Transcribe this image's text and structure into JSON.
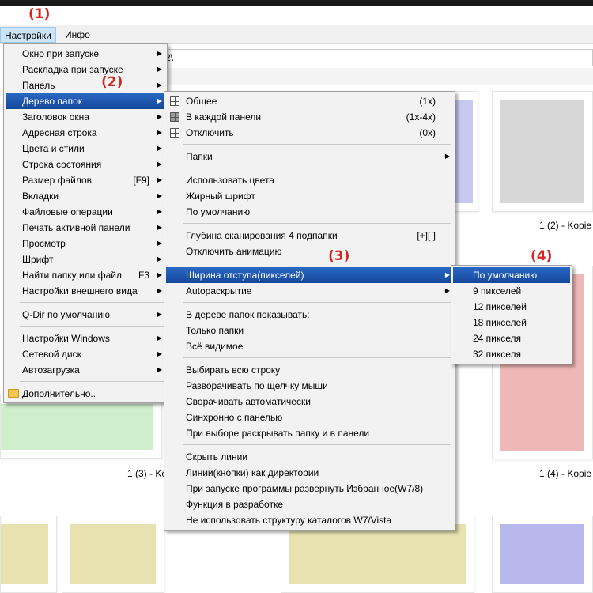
{
  "menubar": {
    "settings": "Настройки",
    "info": "Инфо"
  },
  "address": {
    "value": "2\\"
  },
  "captions": [
    "1 (2) - Kopie",
    "1 (3) - Ko",
    "1 (4) - Kopie"
  ],
  "annotations": [
    "(1)",
    "(2)",
    "(3)",
    "(4)"
  ],
  "menu_settings": {
    "items": [
      {
        "label": "Окно при запуске",
        "shortcut": ""
      },
      {
        "label": "Раскладка при запуске",
        "shortcut": ""
      },
      {
        "label": "Панель",
        "shortcut": ""
      },
      {
        "label": "Дерево папок",
        "shortcut": ""
      },
      {
        "label": "Заголовок окна",
        "shortcut": ""
      },
      {
        "label": "Адресная строка",
        "shortcut": ""
      },
      {
        "label": "Цвета и стили",
        "shortcut": ""
      },
      {
        "label": "Строка состояния",
        "shortcut": ""
      },
      {
        "label": "Размер файлов",
        "shortcut": "[F9]"
      },
      {
        "label": "Вкладки",
        "shortcut": ""
      },
      {
        "label": "Файловые операции",
        "shortcut": ""
      },
      {
        "label": "Печать активной панели",
        "shortcut": ""
      },
      {
        "label": "Просмотр",
        "shortcut": ""
      },
      {
        "label": "Шрифт",
        "shortcut": ""
      },
      {
        "label": "Найти папку или файл",
        "shortcut": "F3"
      },
      {
        "label": "Настройки внешнего вида",
        "shortcut": ""
      },
      {
        "label": "Q-Dir по умолчанию",
        "shortcut": ""
      },
      {
        "label": "Настройки Windows",
        "shortcut": ""
      },
      {
        "label": "Сетевой диск",
        "shortcut": ""
      },
      {
        "label": "Автозагрузка",
        "shortcut": ""
      },
      {
        "label": "Дополнительно..",
        "shortcut": ""
      }
    ]
  },
  "menu_tree": {
    "items": [
      {
        "label": "Общее",
        "shortcut": "(1x)"
      },
      {
        "label": "В каждой панели",
        "shortcut": "(1x-4x)"
      },
      {
        "label": "Отключить",
        "shortcut": "(0x)"
      },
      {
        "label": "Папки",
        "shortcut": ""
      },
      {
        "label": "Использовать цвета",
        "shortcut": ""
      },
      {
        "label": "Жирный шрифт",
        "shortcut": ""
      },
      {
        "label": "По умолчанию",
        "shortcut": ""
      },
      {
        "label": "Глубина сканирования 4 подпапки",
        "shortcut": "[+][ ]"
      },
      {
        "label": "Отключить анимацию",
        "shortcut": ""
      },
      {
        "label": "Ширина отступа(пикселей)",
        "shortcut": ""
      },
      {
        "label": "Autoраскрытие",
        "shortcut": ""
      },
      {
        "label": "В дереве папок показывать:",
        "shortcut": ""
      },
      {
        "label": "Только папки",
        "shortcut": ""
      },
      {
        "label": "Всё видимое",
        "shortcut": ""
      },
      {
        "label": "Выбирать всю строку",
        "shortcut": ""
      },
      {
        "label": "Разворачивать по щелчку мыши",
        "shortcut": ""
      },
      {
        "label": "Сворачивать автоматически",
        "shortcut": ""
      },
      {
        "label": "Синхронно с панелью",
        "shortcut": ""
      },
      {
        "label": "При выборе раскрывать папку и в панели",
        "shortcut": ""
      },
      {
        "label": "Скрыть линии",
        "shortcut": ""
      },
      {
        "label": "Линии(кнопки) как директории",
        "shortcut": ""
      },
      {
        "label": "При запуске программы развернуть Избранное(W7/8)",
        "shortcut": ""
      },
      {
        "label": "Функция в разработке",
        "shortcut": ""
      },
      {
        "label": "Не использовать структуру каталогов W7/Vista",
        "shortcut": ""
      }
    ]
  },
  "menu_indent": {
    "items": [
      {
        "label": "По умолчанию"
      },
      {
        "label": "9 пикселей"
      },
      {
        "label": "12 пикселей"
      },
      {
        "label": "18 пикселей"
      },
      {
        "label": "24 пикселя"
      },
      {
        "label": "32 пикселя"
      }
    ]
  },
  "colors": {
    "highlight": "#1a56b2",
    "annotation": "#d4261f",
    "green": "#b4e0b0",
    "grey": "#c8c8c8",
    "red": "#efb8b8",
    "yellow": "#e8e2b0",
    "blue": "#b8b8ec"
  }
}
